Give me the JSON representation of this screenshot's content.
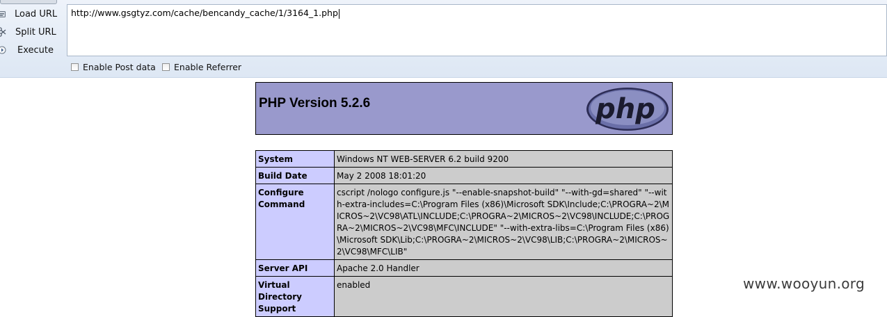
{
  "toolbar": {
    "load_url_label": "Load URL",
    "split_url_label": "Split URL",
    "execute_label": "Execute",
    "url_value": "http://www.gsgtyz.com/cache/bencandy_cache/1/3164_1.php",
    "enable_post_label": "Enable Post data",
    "enable_referrer_label": "Enable Referrer"
  },
  "phpinfo": {
    "title": "PHP Version 5.2.6",
    "logo_text": "php",
    "rows": [
      {
        "key": "System",
        "value": "Windows NT WEB-SERVER 6.2 build 9200"
      },
      {
        "key": "Build Date",
        "value": "May 2 2008 18:01:20"
      },
      {
        "key": "Configure Command",
        "value": "cscript /nologo configure.js \"--enable-snapshot-build\" \"--with-gd=shared\" \"--with-extra-includes=C:\\Program Files (x86)\\Microsoft SDK\\Include;C:\\PROGRA~2\\MICROS~2\\VC98\\ATL\\INCLUDE;C:\\PROGRA~2\\MICROS~2\\VC98\\INCLUDE;C:\\PROGRA~2\\MICROS~2\\VC98\\MFC\\INCLUDE\" \"--with-extra-libs=C:\\Program Files (x86)\\Microsoft SDK\\Lib;C:\\PROGRA~2\\MICROS~2\\VC98\\LIB;C:\\PROGRA~2\\MICROS~2\\VC98\\MFC\\LIB\""
      },
      {
        "key": "Server API",
        "value": "Apache 2.0 Handler"
      },
      {
        "key": "Virtual Directory Support",
        "value": "enabled"
      }
    ]
  },
  "watermark": "www.wooyun.org",
  "colors": {
    "header_bg": "#9999cc",
    "key_cell_bg": "#ccccff",
    "value_cell_bg": "#cccccc",
    "toolbar_bg": "#e4ecf7"
  },
  "icons": [
    "load-url-icon",
    "split-url-icon",
    "execute-icon",
    "php-logo-icon"
  ]
}
